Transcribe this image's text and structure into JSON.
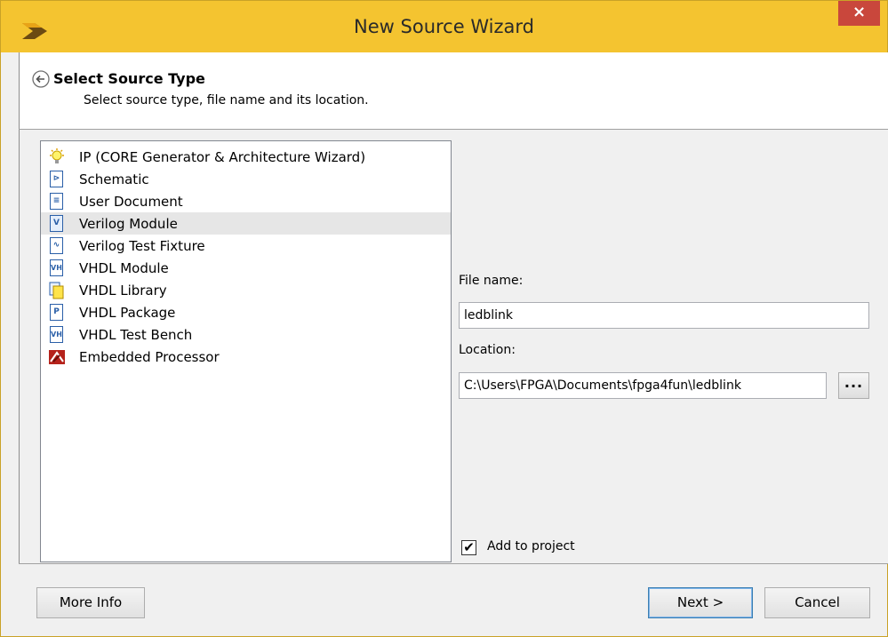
{
  "window": {
    "title": "New Source Wizard",
    "close_label": "×",
    "accent_color": "#f4c430",
    "logo_icon": "xilinx-logo-icon"
  },
  "header": {
    "back_icon": "back-arrow-icon",
    "title": "Select Source Type",
    "subtitle": "Select source type, file name and its location."
  },
  "source_types": [
    {
      "label": "IP (CORE Generator & Architecture Wizard)",
      "icon": "lightbulb-icon",
      "selected": false
    },
    {
      "label": "Schematic",
      "icon": "schematic-icon",
      "selected": false
    },
    {
      "label": "User Document",
      "icon": "document-icon",
      "selected": false
    },
    {
      "label": "Verilog Module",
      "icon": "verilog-module-icon",
      "selected": true
    },
    {
      "label": "Verilog Test Fixture",
      "icon": "waveform-icon",
      "selected": false
    },
    {
      "label": "VHDL Module",
      "icon": "vhdl-module-icon",
      "selected": false
    },
    {
      "label": "VHDL Library",
      "icon": "library-icon",
      "selected": false
    },
    {
      "label": "VHDL Package",
      "icon": "package-icon",
      "selected": false
    },
    {
      "label": "VHDL Test Bench",
      "icon": "test-bench-icon",
      "selected": false
    },
    {
      "label": "Embedded Processor",
      "icon": "processor-icon",
      "selected": false
    }
  ],
  "form": {
    "file_name_label": "File name:",
    "file_name_value": "ledblink",
    "location_label": "Location:",
    "location_value": "C:\\Users\\FPGA\\Documents\\fpga4fun\\ledblink",
    "browse_label": "...",
    "add_to_project_label": "Add to project",
    "add_to_project_checked": true,
    "check_mark": "✔"
  },
  "footer": {
    "more_info_label": "More Info",
    "next_label": "Next >",
    "cancel_label": "Cancel"
  }
}
